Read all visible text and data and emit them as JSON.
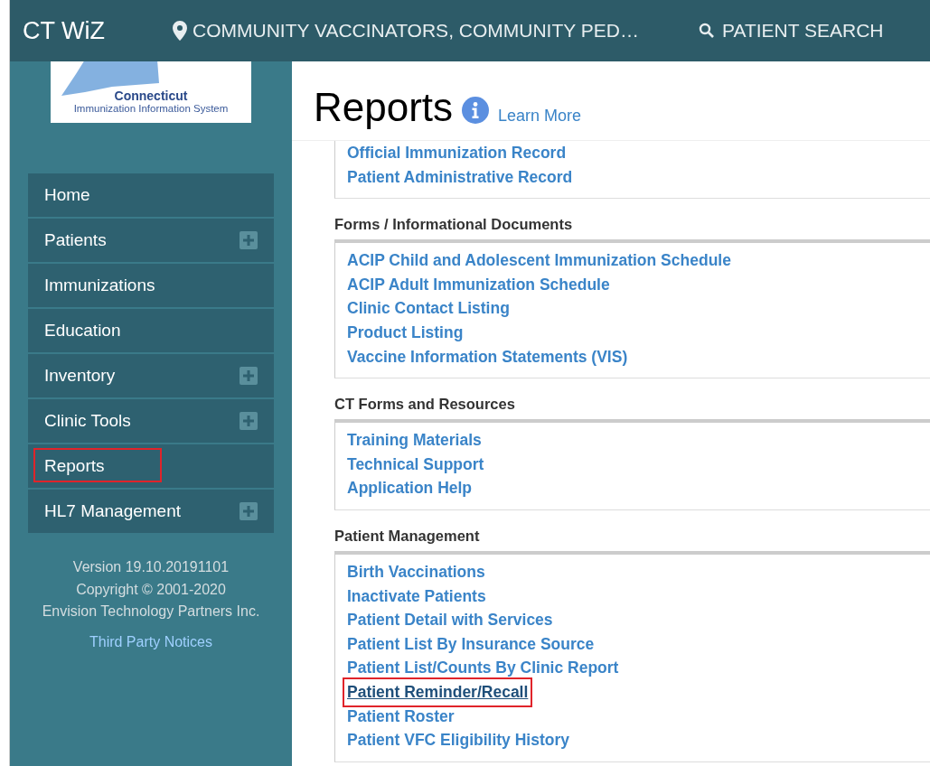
{
  "header": {
    "app_name": "CT WiZ",
    "location": "COMMUNITY VACCINATORS, COMMUNITY PED…",
    "patient_search": "PATIENT SEARCH"
  },
  "logo": {
    "title": "Connecticut",
    "subtitle": "Immunization Information System"
  },
  "sidebar": {
    "items": [
      {
        "label": "Home",
        "has_submenu": false,
        "highlighted": false
      },
      {
        "label": "Patients",
        "has_submenu": true,
        "highlighted": false
      },
      {
        "label": "Immunizations",
        "has_submenu": false,
        "highlighted": false
      },
      {
        "label": "Education",
        "has_submenu": false,
        "highlighted": false
      },
      {
        "label": "Inventory",
        "has_submenu": true,
        "highlighted": false
      },
      {
        "label": "Clinic Tools",
        "has_submenu": true,
        "highlighted": false
      },
      {
        "label": "Reports",
        "has_submenu": false,
        "highlighted": true
      },
      {
        "label": "HL7 Management",
        "has_submenu": true,
        "highlighted": false
      }
    ],
    "footer": [
      "Version 19.10.20191101",
      "Copyright © 2001-2020",
      "Envision Technology Partners Inc."
    ],
    "notices_link": "Third Party Notices"
  },
  "page": {
    "title": "Reports",
    "learn_more": "Learn More"
  },
  "sections": [
    {
      "links": [
        {
          "label": "Official Immunization Record",
          "highlighted": false
        },
        {
          "label": "Patient Administrative Record",
          "highlighted": false
        }
      ]
    },
    {
      "title": "Forms / Informational Documents",
      "links": [
        {
          "label": "ACIP Child and Adolescent Immunization Schedule",
          "highlighted": false
        },
        {
          "label": "ACIP Adult Immunization Schedule",
          "highlighted": false
        },
        {
          "label": "Clinic Contact Listing",
          "highlighted": false
        },
        {
          "label": "Product Listing",
          "highlighted": false
        },
        {
          "label": "Vaccine Information Statements (VIS)",
          "highlighted": false
        }
      ]
    },
    {
      "title": "CT Forms and Resources",
      "links": [
        {
          "label": "Training Materials",
          "highlighted": false
        },
        {
          "label": "Technical Support",
          "highlighted": false
        },
        {
          "label": "Application Help",
          "highlighted": false
        }
      ]
    },
    {
      "title": "Patient Management",
      "links": [
        {
          "label": "Birth Vaccinations",
          "highlighted": false
        },
        {
          "label": "Inactivate Patients",
          "highlighted": false
        },
        {
          "label": "Patient Detail with Services",
          "highlighted": false
        },
        {
          "label": "Patient List By Insurance Source",
          "highlighted": false
        },
        {
          "label": "Patient List/Counts By Clinic Report",
          "highlighted": false
        },
        {
          "label": "Patient Reminder/Recall",
          "highlighted": true
        },
        {
          "label": "Patient Roster",
          "highlighted": false
        },
        {
          "label": "Patient VFC Eligibility History",
          "highlighted": false
        }
      ]
    }
  ]
}
